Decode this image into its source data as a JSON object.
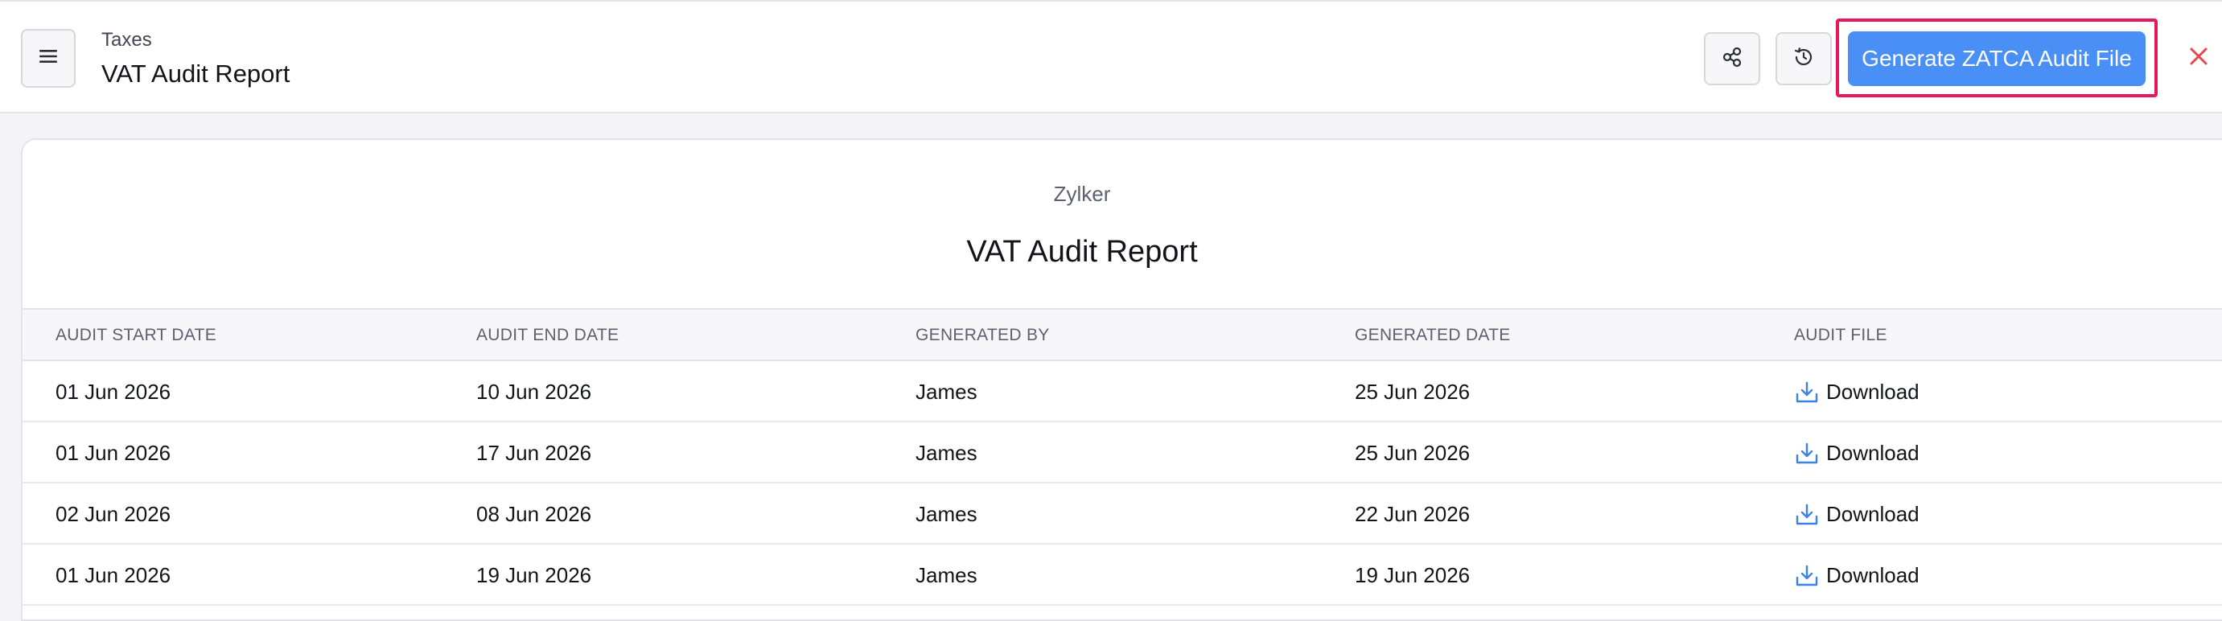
{
  "header": {
    "breadcrumb": "Taxes",
    "title": "VAT Audit Report",
    "menu_icon": "hamburger-icon",
    "share_icon": "share-icon",
    "history_icon": "history-icon",
    "generate_label": "Generate ZATCA Audit File",
    "close_icon": "close-icon"
  },
  "report": {
    "organization": "Zylker",
    "title": "VAT Audit Report",
    "columns": [
      "AUDIT START DATE",
      "AUDIT END DATE",
      "GENERATED BY",
      "GENERATED DATE",
      "AUDIT FILE"
    ],
    "rows": [
      {
        "start": "01 Jun 2026",
        "end": "10 Jun 2026",
        "by": "James",
        "generated": "25 Jun 2026",
        "file": "Download"
      },
      {
        "start": "01 Jun 2026",
        "end": "17 Jun 2026",
        "by": "James",
        "generated": "25 Jun 2026",
        "file": "Download"
      },
      {
        "start": "02 Jun 2026",
        "end": "08 Jun 2026",
        "by": "James",
        "generated": "22 Jun 2026",
        "file": "Download"
      },
      {
        "start": "01 Jun 2026",
        "end": "19 Jun 2026",
        "by": "James",
        "generated": "19 Jun 2026",
        "file": "Download"
      }
    ]
  },
  "colors": {
    "accent": "#4a8ff5",
    "highlight": "#e8175d",
    "close": "#e5484d"
  }
}
